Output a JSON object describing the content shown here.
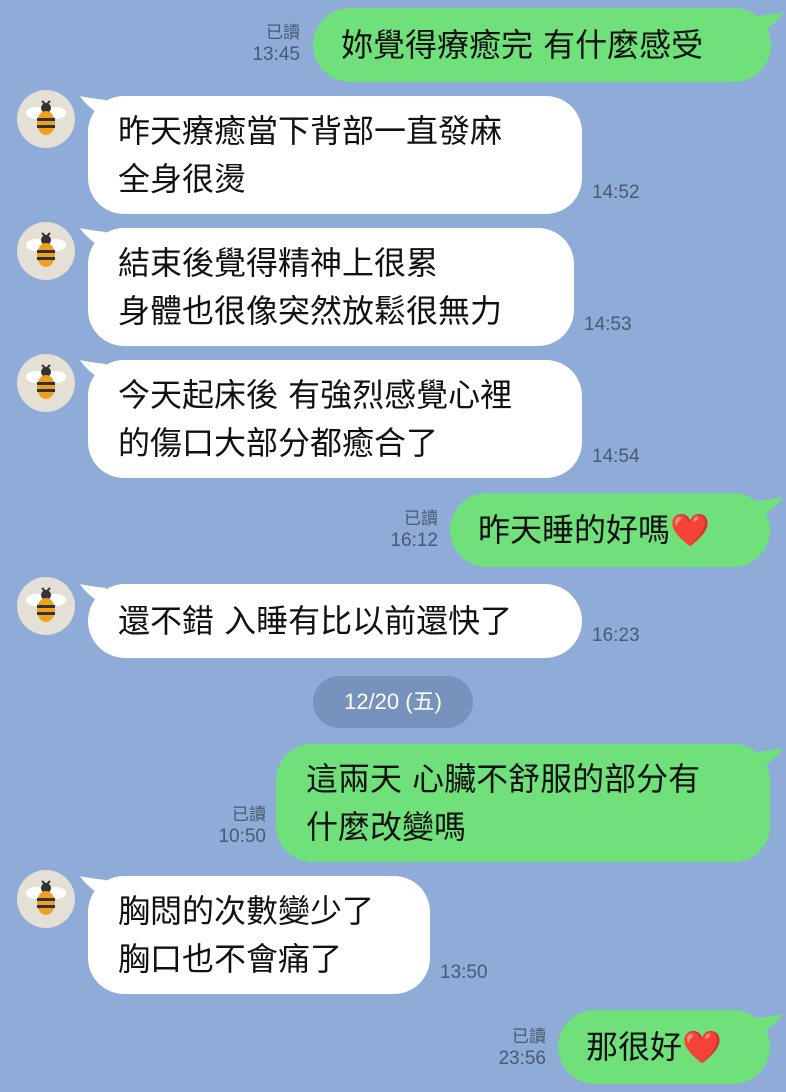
{
  "date_separator": "12/20 (五)",
  "messages": [
    {
      "side": "out",
      "text": "妳覺得療癒完 有什麼感受",
      "read": "已讀",
      "time": "13:45"
    },
    {
      "side": "in",
      "text": "昨天療癒當下背部一直發麻\n全身很燙",
      "time": "14:52"
    },
    {
      "side": "in",
      "text": "結束後覺得精神上很累\n身體也很像突然放鬆很無力",
      "time": "14:53"
    },
    {
      "side": "in",
      "text": "今天起床後 有強烈感覺心裡\n的傷口大部分都癒合了",
      "time": "14:54"
    },
    {
      "side": "out",
      "text": "昨天睡的好嗎❤️",
      "read": "已讀",
      "time": "16:12"
    },
    {
      "side": "in",
      "text": "還不錯 入睡有比以前還快了",
      "time": "16:23"
    },
    {
      "side": "out",
      "text": "這兩天 心臟不舒服的部分有\n什麼改變嗎",
      "read": "已讀",
      "time": "10:50"
    },
    {
      "side": "in",
      "text": "胸悶的次數變少了\n胸口也不會痛了",
      "time": "13:50"
    },
    {
      "side": "out",
      "text": "那很好❤️",
      "read": "已讀",
      "time": "23:56"
    }
  ],
  "colors": {
    "background": "#8fabd8",
    "outgoing_bubble": "#6fe07a",
    "incoming_bubble": "#ffffff",
    "meta_text": "#4a5a72"
  },
  "icons": {
    "avatar": "bee-avatar-icon"
  }
}
